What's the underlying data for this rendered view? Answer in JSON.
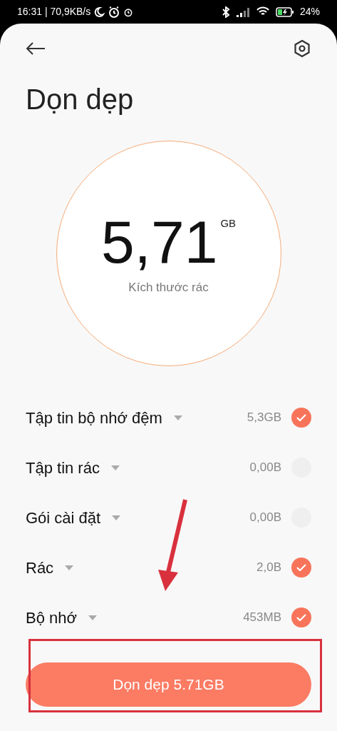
{
  "status_bar": {
    "time": "16:31 | 70,9KB/s",
    "battery": "24%"
  },
  "header": {
    "title": "Dọn dẹp"
  },
  "summary": {
    "value": "5,71",
    "unit": "GB",
    "caption": "Kích thước rác"
  },
  "items": [
    {
      "label": "Tập tin bộ nhớ đệm",
      "size": "5,3GB",
      "checked": true
    },
    {
      "label": "Tập tin rác",
      "size": "0,00B",
      "checked": false
    },
    {
      "label": "Gói cài đặt",
      "size": "0,00B",
      "checked": false
    },
    {
      "label": "Rác",
      "size": "2,0B",
      "checked": true
    },
    {
      "label": "Bộ nhớ",
      "size": "453MB",
      "checked": true
    }
  ],
  "clean_button": {
    "label": "Dọn dẹp 5.71GB"
  },
  "annotations": {
    "arrow": true,
    "highlight_frame": true
  }
}
